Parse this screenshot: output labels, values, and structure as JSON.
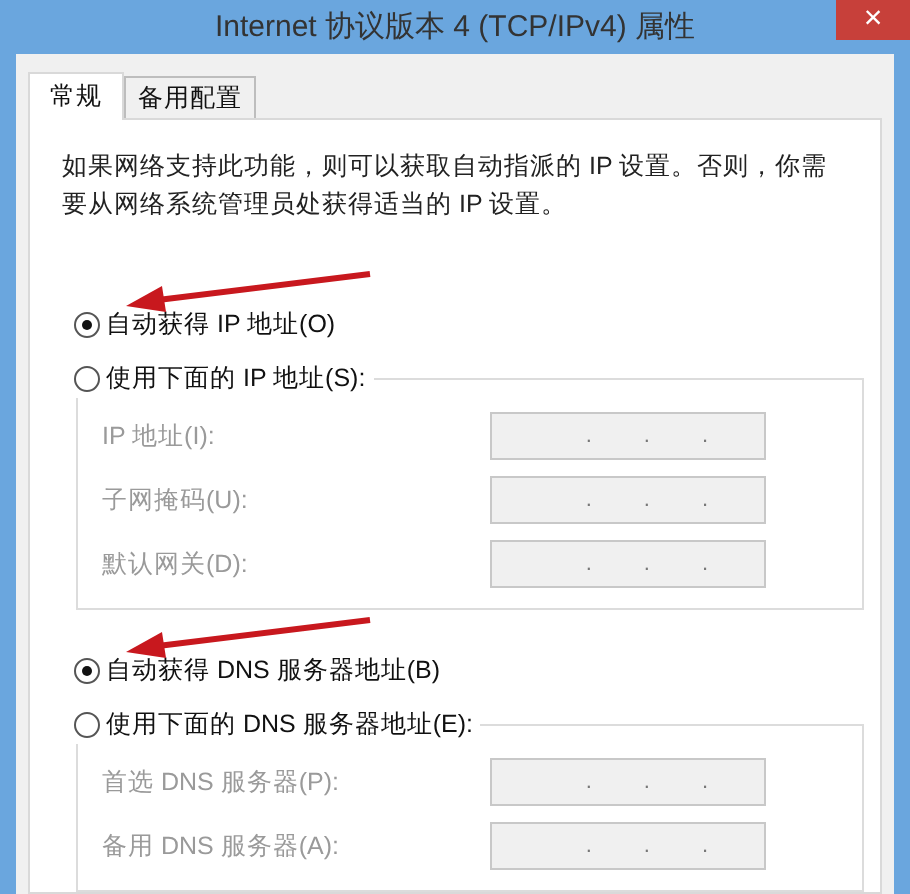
{
  "window": {
    "title": "Internet 协议版本 4 (TCP/IPv4) 属性",
    "close_label": "×"
  },
  "tabs": [
    {
      "label": "常规",
      "selected": true
    },
    {
      "label": "备用配置",
      "selected": false
    }
  ],
  "description": "如果网络支持此功能，则可以获取自动指派的 IP 设置。否则，你需要从网络系统管理员处获得适当的 IP 设置。",
  "sections": [
    {
      "options": [
        {
          "label": "自动获得 IP 地址(O)",
          "selected": true,
          "pointed": true
        },
        {
          "label": "使用下面的 IP 地址(S):",
          "selected": false,
          "pointed": false
        }
      ],
      "fields": [
        {
          "label": "IP 地址(I):",
          "disabled": true,
          "separators": [
            ".",
            ".",
            "."
          ]
        },
        {
          "label": "子网掩码(U):",
          "disabled": true,
          "separators": [
            ".",
            ".",
            "."
          ]
        },
        {
          "label": "默认网关(D):",
          "disabled": true,
          "separators": [
            ".",
            ".",
            "."
          ]
        }
      ]
    },
    {
      "options": [
        {
          "label": "自动获得 DNS 服务器地址(B)",
          "selected": true,
          "pointed": true
        },
        {
          "label": "使用下面的 DNS 服务器地址(E):",
          "selected": false,
          "pointed": false
        }
      ],
      "fields": [
        {
          "label": "首选 DNS 服务器(P):",
          "disabled": true,
          "separators": [
            ".",
            ".",
            "."
          ]
        },
        {
          "label": "备用 DNS 服务器(A):",
          "disabled": true,
          "separators": [
            ".",
            ".",
            "."
          ]
        }
      ]
    }
  ]
}
